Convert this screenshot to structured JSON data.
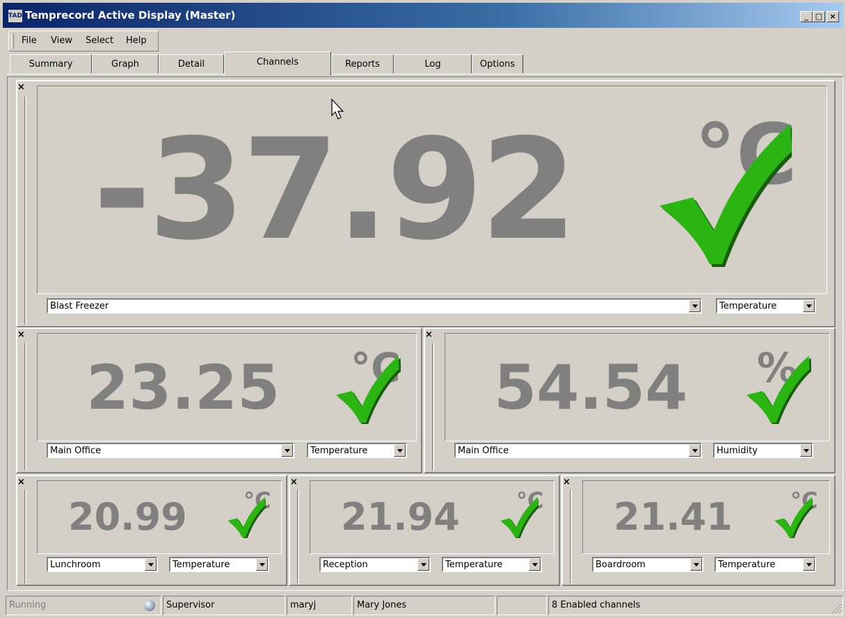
{
  "window": {
    "app_icon_text": "TAD",
    "title": "Temprecord Active Display (Master)"
  },
  "menu": [
    "File",
    "View",
    "Select",
    "Help"
  ],
  "tabs": [
    "Summary",
    "Graph",
    "Detail",
    "Channels",
    "Reports",
    "Log",
    "Options"
  ],
  "active_tab": "Channels",
  "colors": {
    "check_green": "#2bb512",
    "reading_gray": "#808080",
    "titlebar": "#0a246a"
  },
  "channels": [
    {
      "value": "-37.92",
      "unit": "°C",
      "status_icon": "check-icon",
      "location": "Blast Freezer",
      "measure": "Temperature"
    },
    {
      "value": "23.25",
      "unit": "°C",
      "status_icon": "check-icon",
      "location": "Main Office",
      "measure": "Temperature"
    },
    {
      "value": "54.54",
      "unit": "%",
      "status_icon": "check-icon",
      "location": "Main Office",
      "measure": "Humidity"
    },
    {
      "value": "20.99",
      "unit": "°C",
      "status_icon": "check-icon",
      "location": "Lunchroom",
      "measure": "Temperature"
    },
    {
      "value": "21.94",
      "unit": "°C",
      "status_icon": "check-icon",
      "location": "Reception",
      "measure": "Temperature"
    },
    {
      "value": "21.41",
      "unit": "°C",
      "status_icon": "check-icon",
      "location": "Boardroom",
      "measure": "Temperature"
    }
  ],
  "close_symbol": "×",
  "status": {
    "state": "Running",
    "role": "Supervisor",
    "username": "maryj",
    "full_name": "Mary Jones",
    "blank": "",
    "channels": "8 Enabled channels"
  }
}
